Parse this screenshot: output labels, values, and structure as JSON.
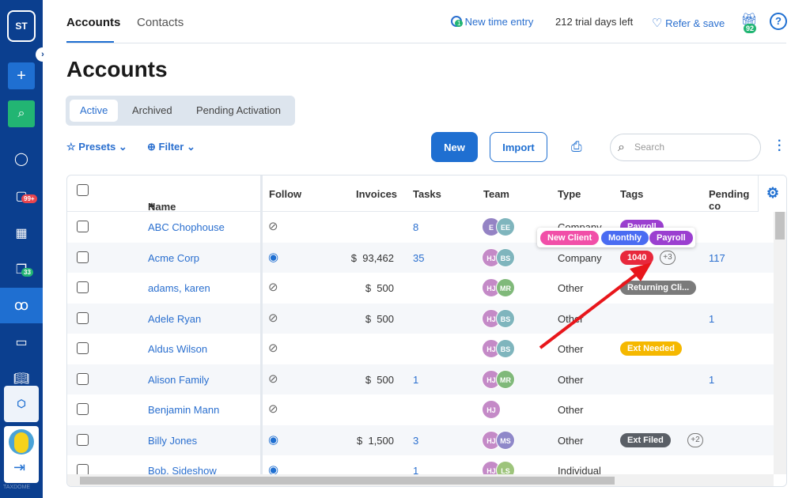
{
  "sidebar": {
    "logo": "ST",
    "inbox_badge": "99+",
    "docs_badge": "33",
    "brand": "TAXDOME"
  },
  "header": {
    "tabs": [
      {
        "label": "Accounts"
      },
      {
        "label": "Contacts"
      }
    ],
    "time_entry_count": "1",
    "time_entry": "New time entry",
    "trial": "212 trial days left",
    "refer": "Refer & save",
    "gift_count": "92",
    "help": "?"
  },
  "page_title": "Accounts",
  "filters": {
    "tabs": [
      "Active",
      "Archived",
      "Pending Activation"
    ],
    "presets": "Presets",
    "filter": "Filter",
    "new": "New",
    "import": "Import",
    "search_placeholder": "Search"
  },
  "columns": [
    "Name",
    "Follow",
    "Invoices",
    "Tasks",
    "Team",
    "Type",
    "Tags",
    "Pending co"
  ],
  "sort_indicator": "^",
  "rows": [
    {
      "name": "ABC Chophouse",
      "follow": false,
      "invoices": "",
      "tasks": "8",
      "team": [
        [
          "E",
          "#9483c4"
        ],
        [
          "EE",
          "#7fb5bd"
        ]
      ],
      "type": "Company",
      "tags": [
        [
          "Payroll",
          "#9b3fd0"
        ]
      ],
      "more": "",
      "pending": ""
    },
    {
      "name": "Acme Corp",
      "follow": true,
      "invoices": "$  93,462",
      "tasks": "35",
      "team": [
        [
          "HJ",
          "#c48ac7"
        ],
        [
          "BS",
          "#7fb5bd"
        ]
      ],
      "type": "Company",
      "tags": [
        [
          "1040",
          "#e8283c"
        ]
      ],
      "more": "+3",
      "pending": "117"
    },
    {
      "name": "adams, karen",
      "follow": false,
      "invoices": "$  500",
      "tasks": "",
      "team": [
        [
          "HJ",
          "#c48ac7"
        ],
        [
          "MR",
          "#80b97a"
        ]
      ],
      "type": "Other",
      "tags": [
        [
          "Returning Cli...",
          "#7b7b7b"
        ]
      ],
      "more": "",
      "pending": ""
    },
    {
      "name": "Adele Ryan",
      "follow": false,
      "invoices": "$  500",
      "tasks": "",
      "team": [
        [
          "HJ",
          "#c48ac7"
        ],
        [
          "BS",
          "#7fb5bd"
        ]
      ],
      "type": "Other",
      "tags": [],
      "more": "",
      "pending": "1"
    },
    {
      "name": "Aldus Wilson",
      "follow": false,
      "invoices": "",
      "tasks": "",
      "team": [
        [
          "HJ",
          "#c48ac7"
        ],
        [
          "BS",
          "#7fb5bd"
        ]
      ],
      "type": "Other",
      "tags": [
        [
          "Ext Needed",
          "#f5b800"
        ]
      ],
      "more": "",
      "pending": ""
    },
    {
      "name": "Alison Family",
      "follow": false,
      "invoices": "$  500",
      "tasks": "1",
      "team": [
        [
          "HJ",
          "#c48ac7"
        ],
        [
          "MR",
          "#80b97a"
        ]
      ],
      "type": "Other",
      "tags": [],
      "more": "",
      "pending": "1"
    },
    {
      "name": "Benjamin Mann",
      "follow": false,
      "invoices": "",
      "tasks": "",
      "team": [
        [
          "HJ",
          "#c48ac7"
        ]
      ],
      "type": "Other",
      "tags": [],
      "more": "",
      "pending": ""
    },
    {
      "name": "Billy Jones",
      "follow": true,
      "invoices": "$  1,500",
      "tasks": "3",
      "team": [
        [
          "HJ",
          "#c48ac7"
        ],
        [
          "MS",
          "#8f88c9"
        ]
      ],
      "type": "Other",
      "tags": [
        [
          "Ext Filed",
          "#5a5f66"
        ]
      ],
      "more": "+2",
      "pending": ""
    },
    {
      "name": "Bob, Sideshow",
      "follow": true,
      "invoices": "",
      "tasks": "1",
      "team": [
        [
          "HJ",
          "#c48ac7"
        ],
        [
          "LS",
          "#9dc47b"
        ]
      ],
      "type": "Individual",
      "tags": [],
      "more": "",
      "pending": ""
    }
  ],
  "tooltip_tags": [
    [
      "New Client",
      "#f14fa8"
    ],
    [
      "Monthly",
      "#4a6cf2"
    ],
    [
      "Payroll",
      "#9b3fd0"
    ]
  ],
  "colors": {
    "sidebar": "#0b3f8f",
    "accent": "#1f6fd1",
    "arrow": "#e8161b"
  }
}
